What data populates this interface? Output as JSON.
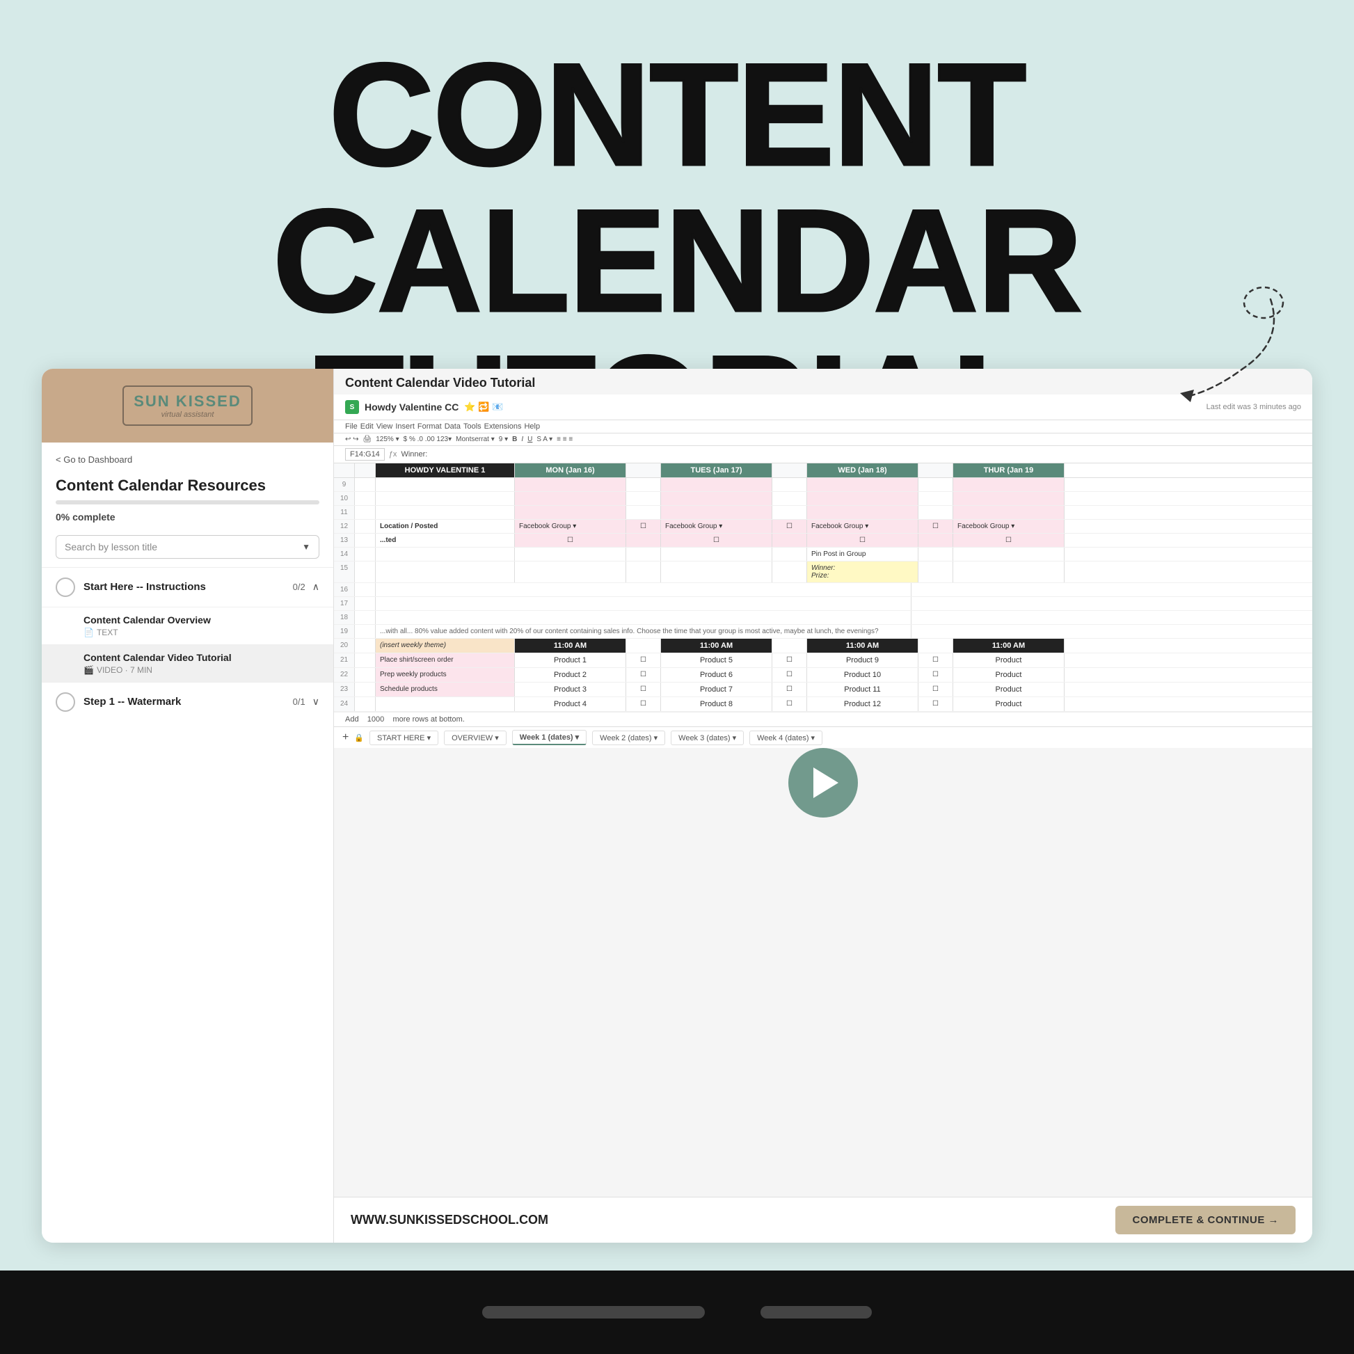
{
  "page": {
    "bg_color": "#d6eae8",
    "title_line1": "CONTENT CALENDAR",
    "title_line2": "TUTORIAL INCLUDED!",
    "website": "WWW.SUNKISSEDSCHOOL.COM"
  },
  "sidebar": {
    "logo_text": "SUN KISSED",
    "logo_sub": "virtual assistant",
    "nav_back": "< Go to Dashboard",
    "course_title": "Content Calendar Resources",
    "progress_text": "0% complete",
    "search_placeholder": "Search by lesson title",
    "sections": [
      {
        "title": "Start Here -- Instructions",
        "count": "0/2",
        "expanded": true,
        "items": [
          {
            "title": "Content Calendar Overview",
            "meta": "TEXT",
            "type": "text",
            "active": false
          },
          {
            "title": "Content Calendar Video Tutorial",
            "meta": "VIDEO · 7 MIN",
            "type": "video",
            "active": true
          }
        ]
      },
      {
        "title": "Step 1 -- Watermark",
        "count": "0/1",
        "expanded": false,
        "items": []
      }
    ]
  },
  "video_panel": {
    "title": "Content Calendar Video Tutorial",
    "spreadsheet_name": "Howdy Valentine CC",
    "last_edit": "Last edit was 3 minutes ago",
    "formula_cell": "F14:G14",
    "formula_value": "Winner:",
    "cols": {
      "a_label": "HOWDY VALENTINE 1",
      "b_label": "MON (Jan 16)",
      "c_label": "TUES (Jan 17)",
      "d_label": "WED (Jan 18)",
      "e_label": "THUR (Jan 19"
    },
    "rows": {
      "row12_label": "Location / Posted",
      "row12_b": "Facebook Group",
      "row12_c": "Facebook Group",
      "row12_d": "Facebook Group",
      "row12_e": "Facebook Group",
      "row13_label": "...ted",
      "row14_b": "",
      "row14_c": "",
      "row14_d": "Pin Post in Group",
      "row14_e": "",
      "row15_d": "Winner:",
      "row15_e": "Prize:",
      "row20_a": "(insert weekly theme)",
      "row20_b": "11:00 AM",
      "row20_c": "11:00 AM",
      "row20_d": "11:00 AM",
      "row21_a": "Place shirt/screen order",
      "row21_b": "Product 1",
      "row21_c": "Product 5",
      "row21_d": "Product 9",
      "row22_a": "Prep weekly products",
      "row22_b": "Product 2",
      "row22_c": "Product 6",
      "row22_d": "Product 10",
      "row23_a": "Schedule products",
      "row23_b": "Product 3",
      "row23_c": "Product 7",
      "row23_d": "Product 11",
      "row24_b": "Product 4",
      "row24_c": "Product 8",
      "row24_d": "Product 12"
    },
    "menu_items": [
      "File",
      "Edit",
      "View",
      "Insert",
      "Format",
      "Data",
      "Tools",
      "Extensions",
      "Help"
    ],
    "tabs": [
      "START HERE ▾",
      "OVERVIEW ▾",
      "Week 1 (dates) ▾",
      "Week 2 (dates) ▾",
      "Week 3 (dates) ▾",
      "Week 4 (dates) ▾"
    ]
  },
  "bottom_bar": {
    "website": "WWW.SUNKISSEDSCHOOL.COM",
    "complete_btn": "COMPLETE & CONTINUE →"
  }
}
